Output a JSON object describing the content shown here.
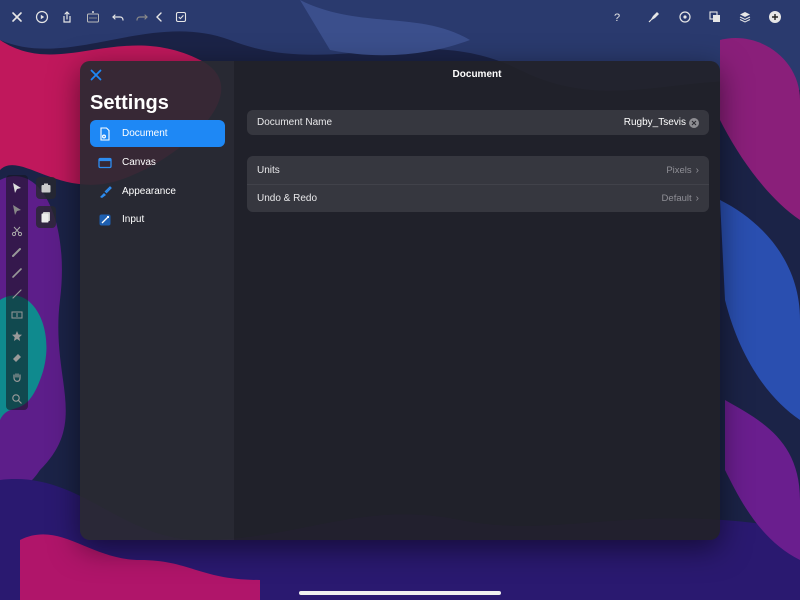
{
  "toolbar": {
    "left_icons": [
      "close-icon",
      "play-icon",
      "share-icon",
      "grid-icon",
      "undo-icon",
      "redo-icon",
      "back-icon",
      "checkbox-icon"
    ],
    "right_icons": [
      "help-icon",
      "pen-style-icon",
      "target-icon",
      "transform-icon",
      "layers-icon",
      "add-icon"
    ]
  },
  "settings": {
    "title": "Settings",
    "items": [
      {
        "label": "Document",
        "icon": "document-gear-icon",
        "active": true
      },
      {
        "label": "Canvas",
        "icon": "canvas-icon",
        "active": false
      },
      {
        "label": "Appearance",
        "icon": "appearance-icon",
        "active": false
      },
      {
        "label": "Input",
        "icon": "input-icon",
        "active": false
      }
    ]
  },
  "detail": {
    "title": "Document",
    "document_name_label": "Document Name",
    "document_name_value": "Rugby_Tsevis",
    "units_label": "Units",
    "units_value": "Pixels",
    "undo_label": "Undo & Redo",
    "undo_value": "Default"
  },
  "colors": {
    "accent": "#1e88f5",
    "modal_bg": "#2b2b32",
    "secondary_text": "#8f8f96"
  }
}
